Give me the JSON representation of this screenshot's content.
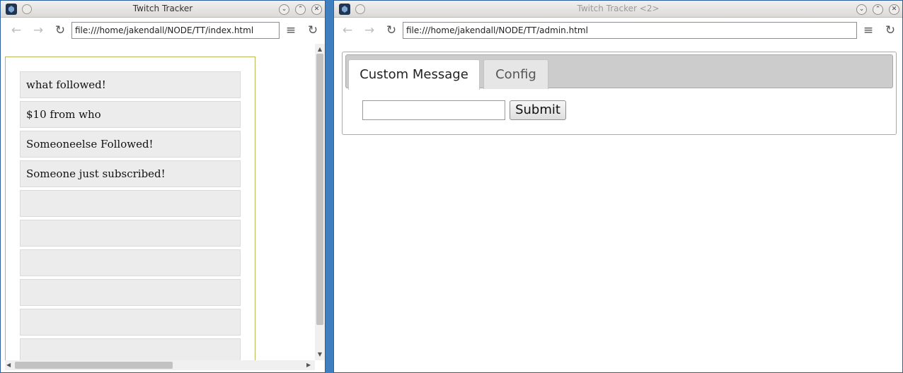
{
  "left_window": {
    "title": "Twitch Tracker",
    "url": "file:///home/jakendall/NODE/TT/index.html",
    "alerts": [
      "what followed!",
      "$10 from who",
      "Someoneelse Followed!",
      "Someone just subscribed!",
      "",
      "",
      "",
      "",
      "",
      ""
    ]
  },
  "right_window": {
    "title": "Twitch Tracker <2>",
    "url": "file:///home/jakendall/NODE/TT/admin.html",
    "tabs": [
      {
        "label": "Custom Message",
        "active": true
      },
      {
        "label": "Config",
        "active": false
      }
    ],
    "message_input": {
      "value": "",
      "placeholder": ""
    },
    "submit_label": "Submit"
  },
  "icons": {
    "back": "back-arrow-icon",
    "forward": "forward-arrow-icon",
    "reload": "reload-icon",
    "menu": "hamburger-menu-icon",
    "minimize": "minimize-icon",
    "maximize": "maximize-icon",
    "close": "close-icon"
  },
  "colors": {
    "desktop": "#3f7fbf",
    "alert_row_bg": "#ececec",
    "alert_box_border": "#b8b856",
    "tabs_nav_bg": "#cccccc"
  }
}
